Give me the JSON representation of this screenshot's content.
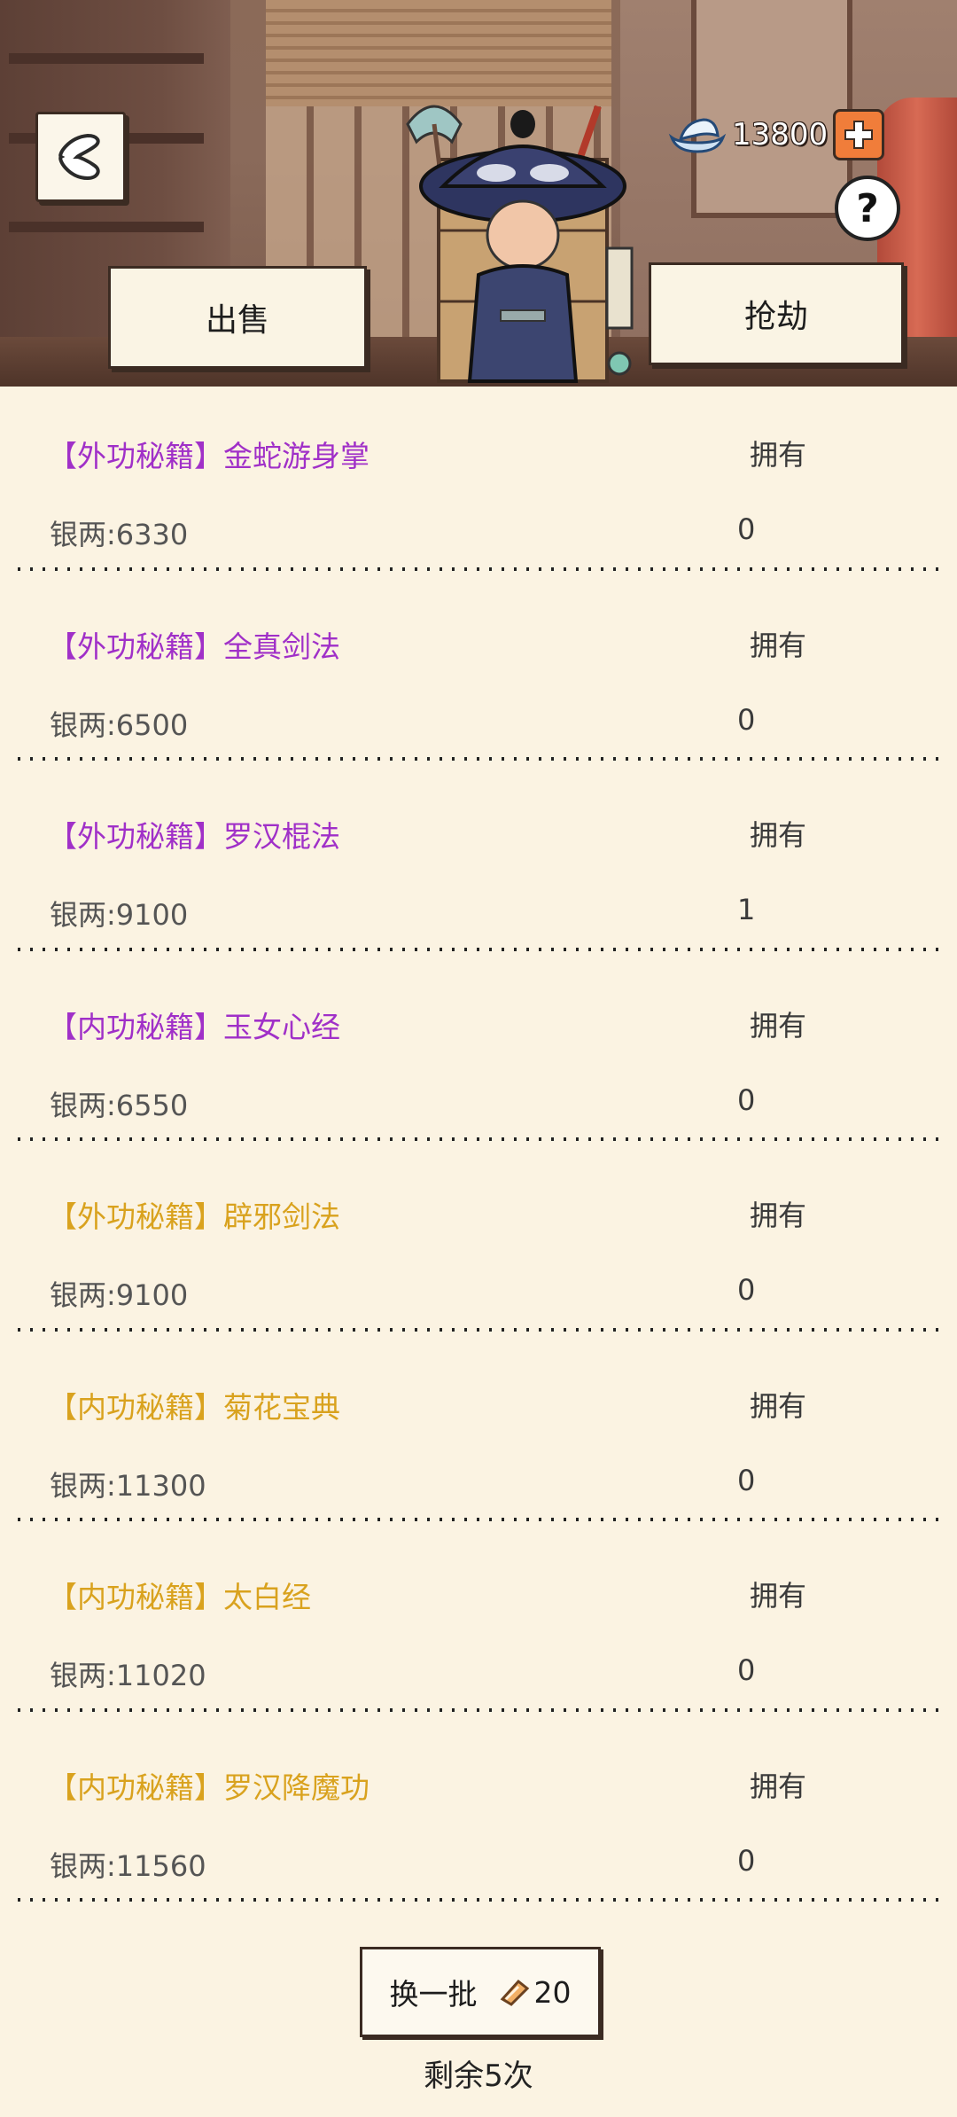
{
  "header": {
    "sell_label": "出售",
    "rob_label": "抢劫",
    "currency_amount": "13800",
    "help_label": "?"
  },
  "items": [
    {
      "title": "【外功秘籍】金蛇游身掌",
      "rarity_color": "#a030c8",
      "price": "银两:6330",
      "own_label": "拥有",
      "own_count": "0"
    },
    {
      "title": "【外功秘籍】全真剑法",
      "rarity_color": "#a030c8",
      "price": "银两:6500",
      "own_label": "拥有",
      "own_count": "0"
    },
    {
      "title": "【外功秘籍】罗汉棍法",
      "rarity_color": "#a030c8",
      "price": "银两:9100",
      "own_label": "拥有",
      "own_count": "1"
    },
    {
      "title": "【内功秘籍】玉女心经",
      "rarity_color": "#a030c8",
      "price": "银两:6550",
      "own_label": "拥有",
      "own_count": "0"
    },
    {
      "title": "【外功秘籍】辟邪剑法",
      "rarity_color": "#d9a21e",
      "price": "银两:9100",
      "own_label": "拥有",
      "own_count": "0"
    },
    {
      "title": "【内功秘籍】菊花宝典",
      "rarity_color": "#d9a21e",
      "price": "银两:11300",
      "own_label": "拥有",
      "own_count": "0"
    },
    {
      "title": "【内功秘籍】太白经",
      "rarity_color": "#d9a21e",
      "price": "银两:11020",
      "own_label": "拥有",
      "own_count": "0"
    },
    {
      "title": "【内功秘籍】罗汉降魔功",
      "rarity_color": "#d9a21e",
      "price": "银两:11560",
      "own_label": "拥有",
      "own_count": "0"
    }
  ],
  "footer": {
    "refresh_label": "换一批",
    "refresh_cost": "20",
    "remaining_text": "剩余5次"
  },
  "icons": {
    "back": "back-arrow-icon",
    "currency": "silver-ingot-icon",
    "plus": "plus-icon",
    "help": "question-mark-icon",
    "token": "refresh-token-icon"
  }
}
